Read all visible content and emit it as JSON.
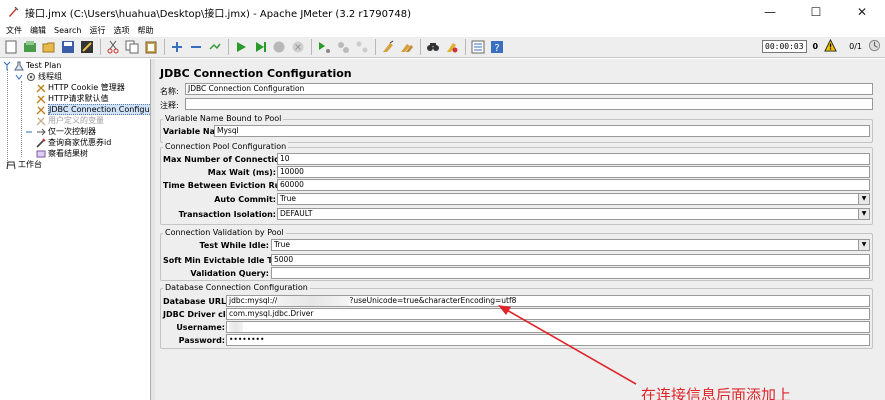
{
  "window": {
    "title": "接口.jmx (C:\\Users\\huahua\\Desktop\\接口.jmx) - Apache JMeter (3.2 r1790748)",
    "minimize": "—",
    "maximize": "☐",
    "close": "✕"
  },
  "menu": [
    "文件",
    "编辑",
    "Search",
    "运行",
    "选项",
    "帮助"
  ],
  "toolbar": {
    "timer": "00:00:03",
    "error_count": "0",
    "threads": "0/1"
  },
  "tree": {
    "items": [
      {
        "label": "Test Plan"
      },
      {
        "label": "线程组"
      },
      {
        "label": "HTTP Cookie 管理器"
      },
      {
        "label": "HTTP请求默认值"
      },
      {
        "label": "JDBC Connection Configuration"
      },
      {
        "label": "用户定义的变量"
      },
      {
        "label": "仅一次控制器"
      },
      {
        "label": "查询商家优惠券id"
      },
      {
        "label": "察看结果树"
      },
      {
        "label": "工作台"
      }
    ]
  },
  "main": {
    "panel_title": "JDBC Connection Configuration",
    "name_label": "名称:",
    "name_value": "JDBC Connection Configuration",
    "comment_label": "注释:",
    "comment_value": "",
    "sections": {
      "variable_name": {
        "title": "Variable Name Bound to Pool",
        "label": "Variable Name:",
        "value": "Mysql"
      },
      "pool": {
        "title": "Connection Pool Configuration",
        "fields": [
          {
            "label": "Max Number of Connections:",
            "value": "10"
          },
          {
            "label": "Max Wait (ms):",
            "value": "10000"
          },
          {
            "label": "Time Between Eviction Runs (ms):",
            "value": "60000"
          },
          {
            "label": "Auto Commit:",
            "value": "True"
          },
          {
            "label": "Transaction Isolation:",
            "value": "DEFAULT"
          }
        ]
      },
      "validation": {
        "title": "Connection Validation by Pool",
        "fields": [
          {
            "label": "Test While Idle:",
            "value": "True"
          },
          {
            "label": "Soft Min Evictable Idle Time(ms):",
            "value": "5000"
          },
          {
            "label": "Validation Query:",
            "value": ""
          }
        ]
      },
      "database": {
        "title": "Database Connection Configuration",
        "fields": [
          {
            "label": "Database URL:",
            "value_prefix": "jdbc:mysql://",
            "value_suffix": "?useUnicode=true&characterEncoding=utf8"
          },
          {
            "label": "JDBC Driver class:",
            "value": "com.mysql.jdbc.Driver"
          },
          {
            "label": "Username:",
            "value": ""
          },
          {
            "label": "Password:",
            "value": "••••••••"
          }
        ]
      }
    }
  },
  "annotation": {
    "text": "在连接信息后面添加上",
    "color": "#e0242a"
  }
}
